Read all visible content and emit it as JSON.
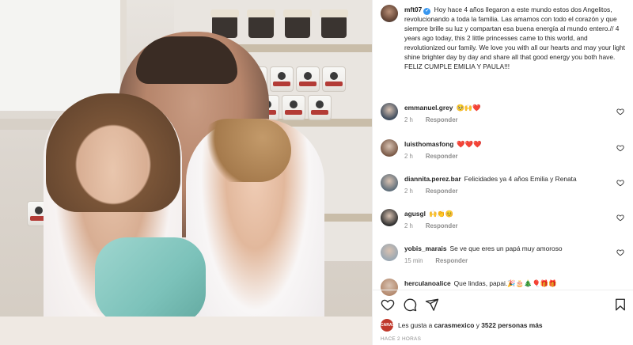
{
  "post": {
    "author": "mft07",
    "verified_mark": "✓",
    "caption": "Hoy hace 4 años llegaron a este mundo estos dos Angelitos, revolucionando a toda la familia. Las amamos con todo el corazón y que siempre brille su luz y compartan esa buena energía al mundo entero.// 4 years ago today, this 2 little princesses came to this world, and revolutionized our family. We love you with all our hearts and may your light shine brighter day by day and share all that good energy you both have. FELIZ CUMPLE EMILIA Y PAULA!!!"
  },
  "comments": [
    {
      "user": "emmanuel.grey",
      "text": "🥺🙌❤️",
      "age": "2 h",
      "reply": "Responder",
      "avatar_color": "#3d4b5c"
    },
    {
      "user": "luisthomasfong",
      "text": "❤️❤️❤️",
      "age": "2 h",
      "reply": "Responder",
      "avatar_color": "#7a5a48"
    },
    {
      "user": "diannita.perez.bar",
      "text": "Felicidades ya 4 años Emilia y Renata",
      "age": "2 h",
      "reply": "Responder",
      "avatar_color": "#5f6e7a"
    },
    {
      "user": "agusgl",
      "text": "🙌👏😊",
      "age": "2 h",
      "reply": "Responder",
      "avatar_color": "#2e2e2e"
    },
    {
      "user": "yobis_marais",
      "text": "Se ve que eres un papá muy amoroso",
      "age": "15 min",
      "reply": "Responder",
      "avatar_color": "#9aa7b2"
    },
    {
      "user": "herculanoalice",
      "text": "Que lindas, papai.🎉🎂🎄🎈🎁🎁",
      "age": "",
      "reply": "",
      "avatar_color": "#b48a6e"
    }
  ],
  "actions": {
    "like": "heart-outline-icon",
    "comment": "comment-bubble-icon",
    "share": "paper-plane-icon",
    "save": "bookmark-icon"
  },
  "likes": {
    "avatar_label": "CARAS",
    "prefix": "Les gusta a ",
    "user": "carasmexico",
    "middle": " y ",
    "count": "3522 personas más"
  },
  "timestamp": "HACE 2 HORAS",
  "colors": {
    "verified": "#3897f0",
    "heart_red": "#ed4956",
    "muted": "#8e8e8e"
  }
}
